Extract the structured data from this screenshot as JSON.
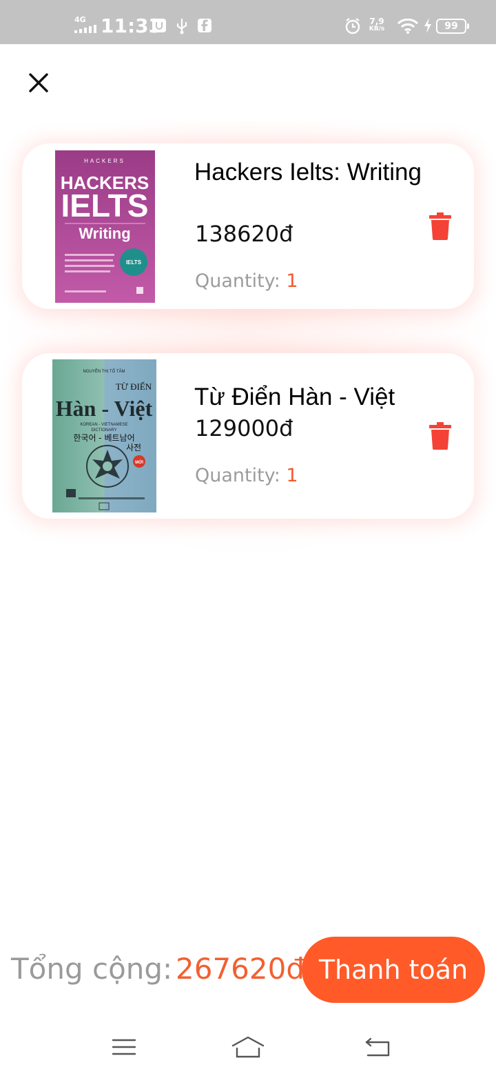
{
  "status_bar": {
    "network": "4G",
    "time": "11:33",
    "speed_value": "7,9",
    "speed_unit": "KB/s",
    "battery": "99",
    "icons": [
      "signal-icon",
      "usb-debug-icon",
      "usb-icon",
      "facebook-icon",
      "alarm-icon",
      "wifi-icon",
      "charging-icon",
      "battery-icon"
    ]
  },
  "header": {
    "close_icon": "close-icon"
  },
  "cart": {
    "quantity_label": "Quantity:",
    "items": [
      {
        "title": "Hackers Ielts: Writing",
        "price": "138620đ",
        "quantity": "1",
        "cover": {
          "brand": "HACKERS",
          "line1": "HACKERS",
          "line2": "IELTS",
          "line3": "Writing",
          "badge": "IELTS",
          "colors": [
            "#9d3f8a",
            "#c15aa6"
          ]
        }
      },
      {
        "title": "Từ Điển Hàn - Việt",
        "price": "129000đ",
        "quantity": "1",
        "cover": {
          "author": "NGUYỄN THỊ TỐ TÂM",
          "line1": "TỪ ĐIỂN",
          "line2": "Hàn - Việt",
          "line3": "KOREAN - VIETNAMESE",
          "line4": "DICTIONARY",
          "line5": "한국어 - 베트남어",
          "line6": "사전",
          "badge": "MỚI",
          "colors": [
            "#6faa98",
            "#8fb7c7"
          ]
        }
      }
    ]
  },
  "footer": {
    "total_label": "Tổng cộng:",
    "total_value": "267620đ",
    "checkout_label": "Thanh toán"
  },
  "colors": {
    "accent": "#ff5a28",
    "price_accent": "#f26030",
    "trash": "#f44336",
    "muted": "#9a9a9a"
  },
  "nav": {
    "icons": [
      "menu-icon",
      "home-icon",
      "back-icon"
    ]
  }
}
